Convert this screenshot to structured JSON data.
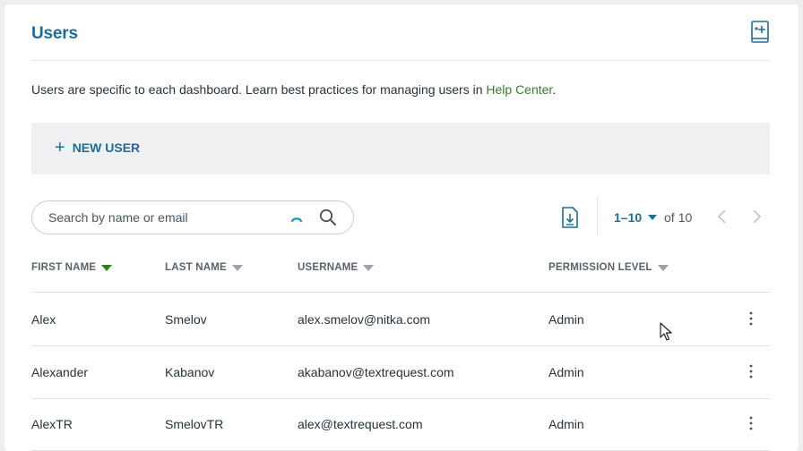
{
  "header": {
    "title": "Users",
    "help_icon": "book-plus-icon"
  },
  "description": {
    "text": "Users are specific to each dashboard. Learn best practices for managing users in ",
    "link_label": "Help Center",
    "suffix": "."
  },
  "toolbar": {
    "new_user_label": "NEW USER",
    "new_user_icon": "plus-icon"
  },
  "search": {
    "placeholder": "Search by name or email",
    "value": ""
  },
  "pagination": {
    "range": "1–10",
    "of_label": "of",
    "total": "10"
  },
  "table": {
    "columns": [
      {
        "label": "FIRST NAME",
        "sort_active": true
      },
      {
        "label": "LAST NAME",
        "sort_active": false
      },
      {
        "label": "USERNAME",
        "sort_active": false
      },
      {
        "label": "PERMISSION LEVEL",
        "sort_active": false
      }
    ],
    "rows": [
      {
        "first": "Alex",
        "last": "Smelov",
        "username": "alex.smelov@nitka.com",
        "permission": "Admin"
      },
      {
        "first": "Alexander",
        "last": "Kabanov",
        "username": "akabanov@textrequest.com",
        "permission": "Admin"
      },
      {
        "first": "AlexTR",
        "last": "SmelovTR",
        "username": "alex@textrequest.com",
        "permission": "Admin"
      }
    ]
  },
  "colors": {
    "accent": "#1e6e93",
    "link": "#3a7d2c",
    "sort_active": "#2f7d21"
  }
}
